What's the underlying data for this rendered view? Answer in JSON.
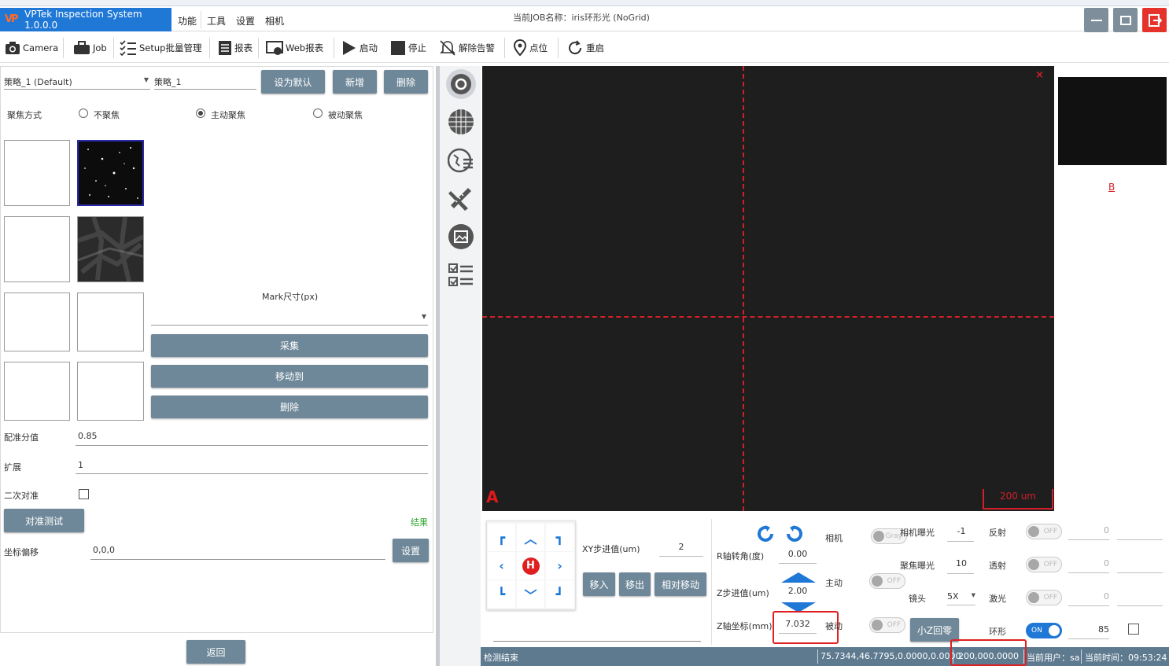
{
  "app": {
    "title": "VPTek Inspection System 1.0.0.0",
    "logo": "VP"
  },
  "menu": [
    "功能",
    "工具",
    "设置",
    "相机"
  ],
  "header": {
    "job_name": "当前JOB名称：iris环形光 (NoGrid)"
  },
  "toolbar": {
    "camera": "Camera",
    "job": "Job",
    "setup": "Setup批量管理",
    "report": "报表",
    "web_report": "Web报表",
    "start": "启动",
    "stop": "停止",
    "clear_alarm": "解除告警",
    "point": "点位",
    "restart": "重启"
  },
  "strategy": {
    "selected": "策略_1 (Default)",
    "name_value": "策略_1",
    "set_default": "设为默认",
    "add": "新增",
    "delete": "删除"
  },
  "focus": {
    "label": "聚焦方式",
    "options": [
      "不聚焦",
      "主动聚焦",
      "被动聚焦"
    ],
    "selected_index": 1
  },
  "mark": {
    "size_label": "Mark尺寸(px)",
    "size_value": "",
    "capture": "采集",
    "move_to": "移动到",
    "delete": "删除"
  },
  "params": {
    "match_label": "配准分值",
    "match_value": "0.85",
    "expand_label": "扩展",
    "expand_value": "1",
    "secondary_label": "二次对准",
    "secondary_checked": false,
    "align_test": "对准测试",
    "result_label": "结果",
    "offset_label": "坐标偏移",
    "offset_value": "0,0,0",
    "set_button": "设置",
    "back_button": "返回"
  },
  "camview": {
    "marker_a": "A",
    "scale": "200 um",
    "close": "×"
  },
  "right": {
    "marker_b": "B"
  },
  "motion": {
    "xy_step_label": "XY步进值(um)",
    "xy_step_value": "2",
    "move_in": "移入",
    "move_out": "移出",
    "relative_move": "相对移动",
    "home": "H",
    "r_angle_label": "R轴转角(度)",
    "r_angle_value": "0.00",
    "z_step_label": "Z步进值(um)",
    "z_step_value": "2.00",
    "z_coord_label": "Z轴坐标(mm)",
    "z_coord_value": "7.032",
    "small_z_zero": "小Z回零"
  },
  "camera_ctrl": {
    "camera_label": "相机",
    "gray_label": "Gray",
    "exposure_label": "相机曝光",
    "exposure_value": "-1",
    "focus_exposure_label": "聚焦曝光",
    "focus_exposure_value": "10",
    "active_label": "主动",
    "lens_label": "镜头",
    "lens_value": "5X",
    "passive_label": "被动",
    "off": "OFF",
    "on": "ON"
  },
  "lights": [
    {
      "label": "反射",
      "state": "OFF",
      "value": "0"
    },
    {
      "label": "透射",
      "state": "OFF",
      "value": "0"
    },
    {
      "label": "激光",
      "state": "OFF",
      "value": "0"
    },
    {
      "label": "环形",
      "state": "ON",
      "value": "85"
    }
  ],
  "status": {
    "message": "检测结束",
    "coords": "75.7344,46.7795,0.0000,0.0000",
    "coords2": "200,000.0000",
    "user": "当前用户：sa",
    "time": "当前时间：09:53:24"
  },
  "colors": {
    "accent": "#1f78d6",
    "button": "#6f8899",
    "status_bar": "#5e7a8f",
    "crosshair": "#d0202a",
    "highlight": "#e02020"
  }
}
